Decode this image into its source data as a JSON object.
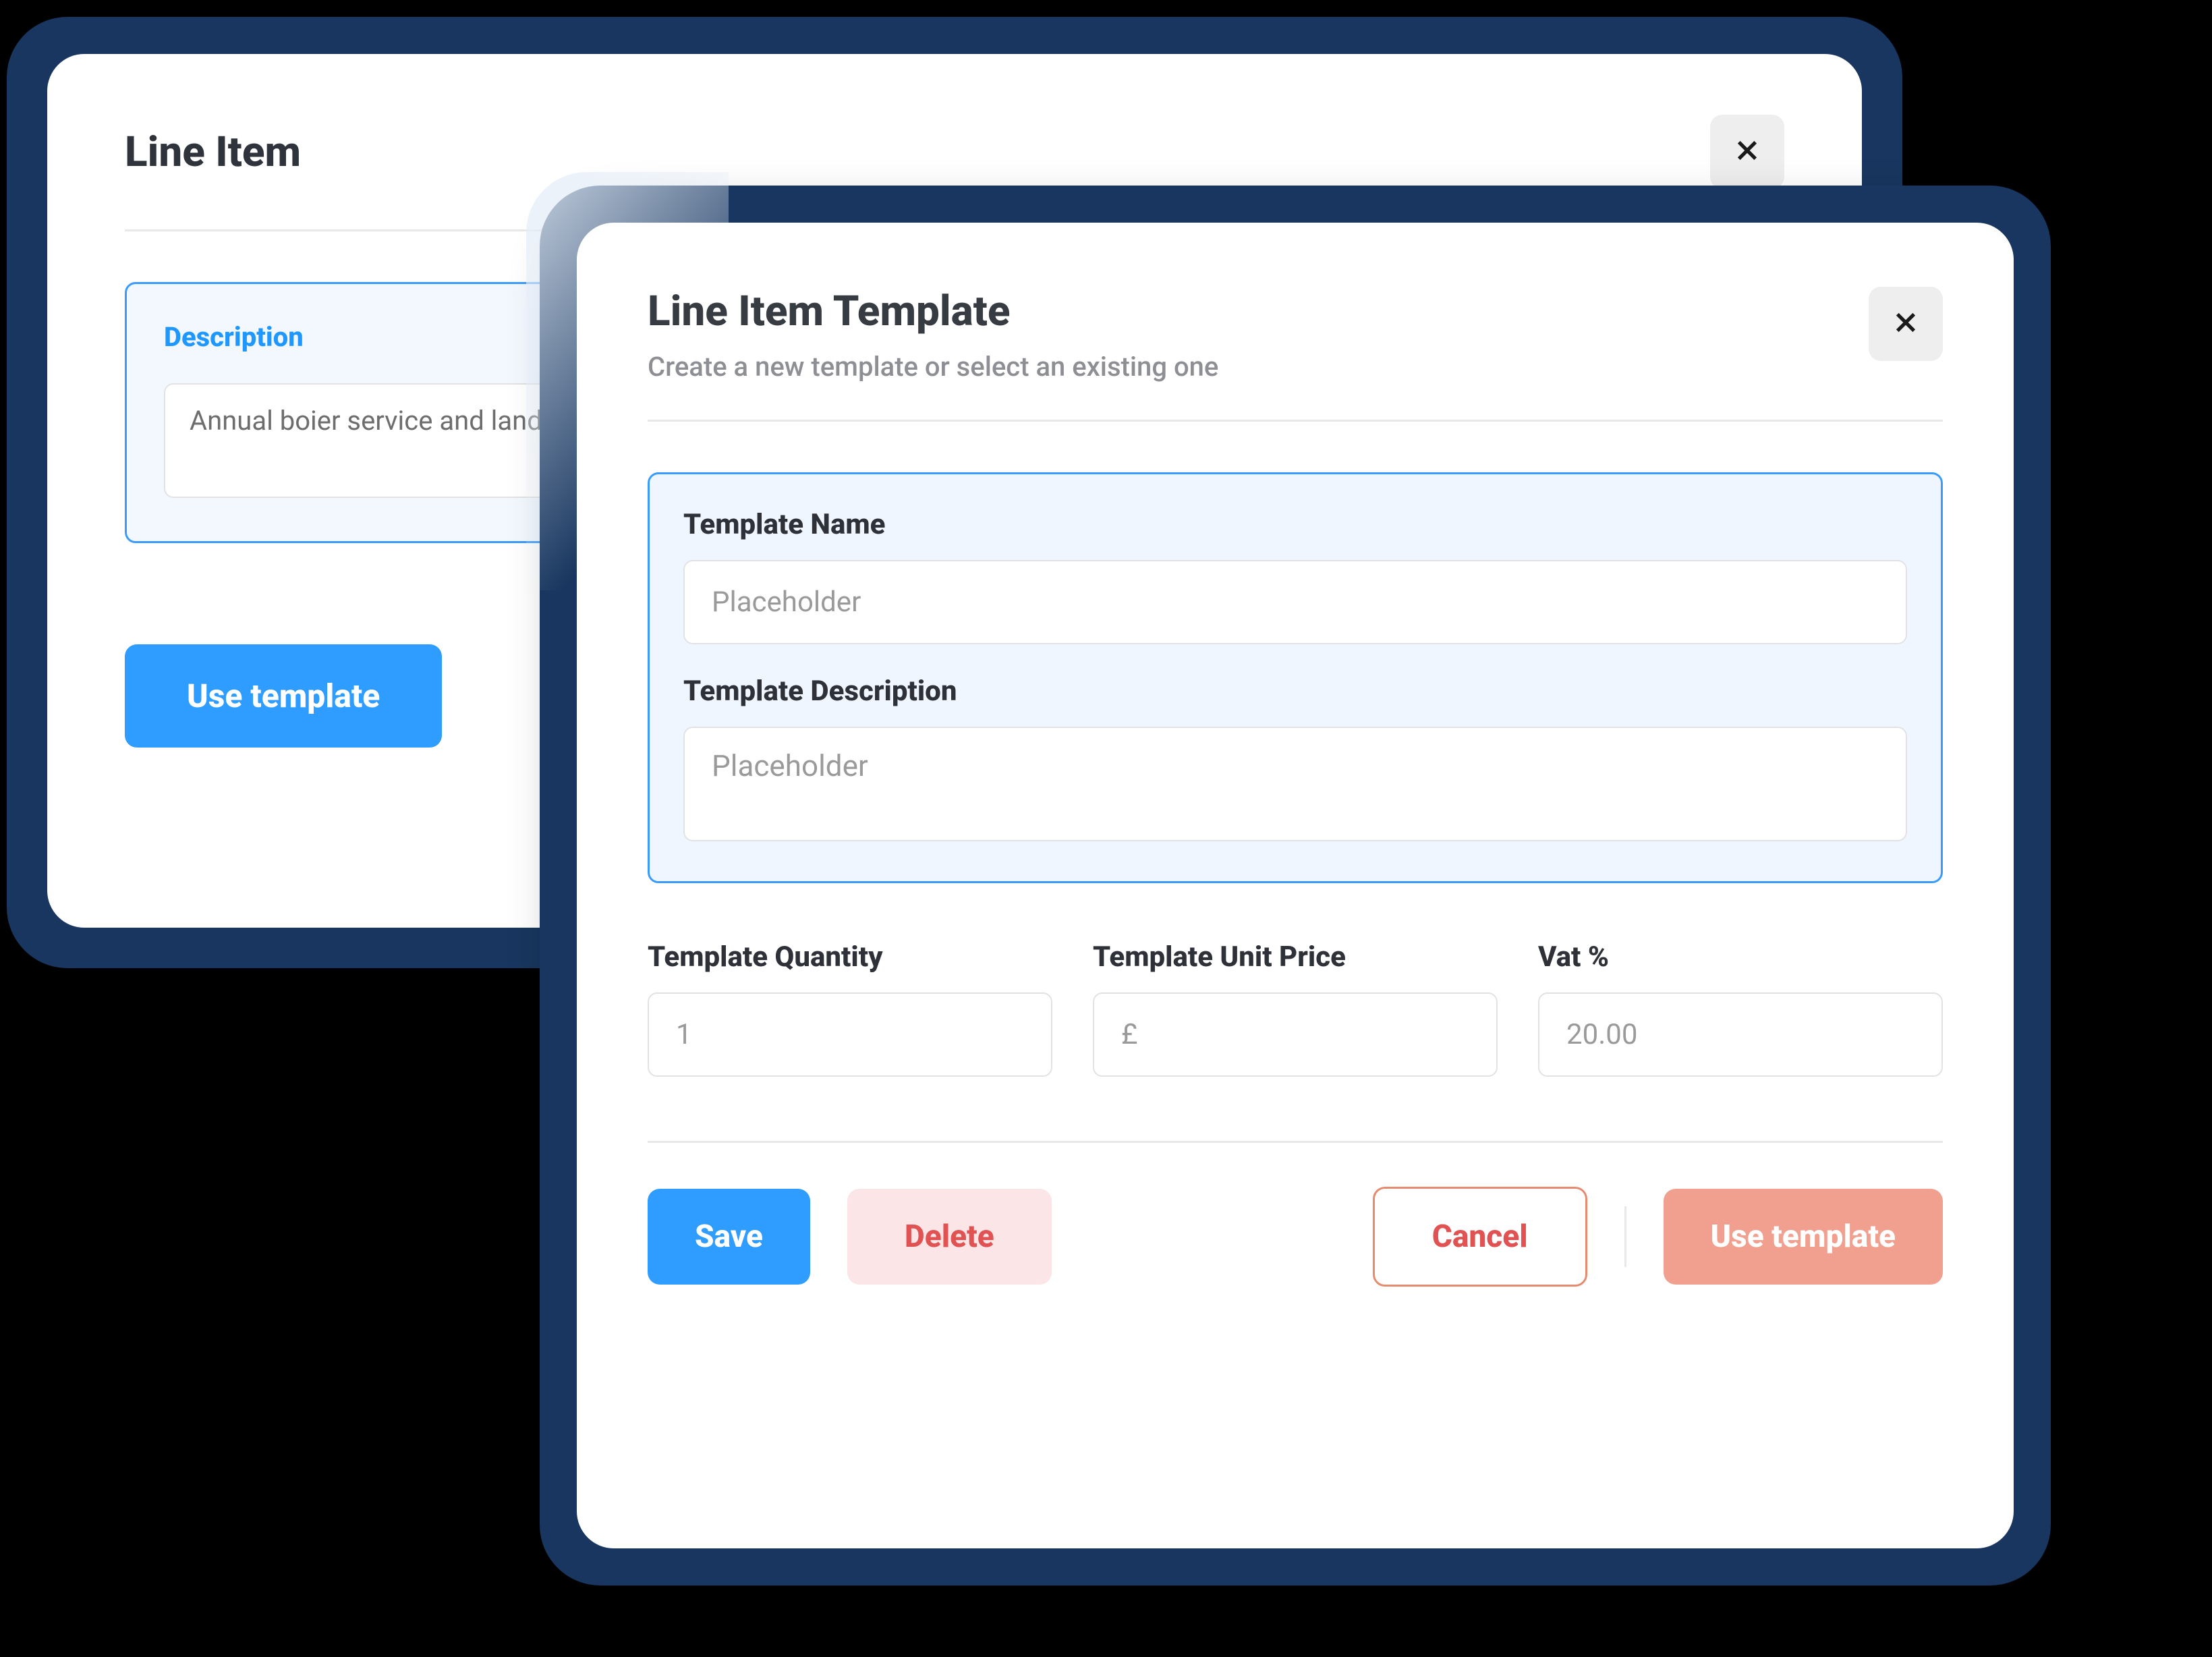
{
  "back": {
    "title": "Line Item",
    "description_label": "Description",
    "description_value": "Annual boier service and landlor",
    "use_template_label": "Use template"
  },
  "front": {
    "title": "Line Item Template",
    "subtitle": "Create a new template or select an existing one",
    "name_label": "Template Name",
    "name_placeholder": "Placeholder",
    "desc_label": "Template Description",
    "desc_placeholder": "Placeholder",
    "qty_label": "Template Quantity",
    "qty_placeholder": "1",
    "price_label": "Template Unit Price",
    "price_placeholder": "£",
    "vat_label": "Vat %",
    "vat_placeholder": "20.00",
    "buttons": {
      "save": "Save",
      "delete": "Delete",
      "cancel": "Cancel",
      "use_template": "Use template"
    }
  },
  "colors": {
    "frame": "#18365f",
    "accent": "#2f9dff",
    "danger": "#e05352"
  }
}
